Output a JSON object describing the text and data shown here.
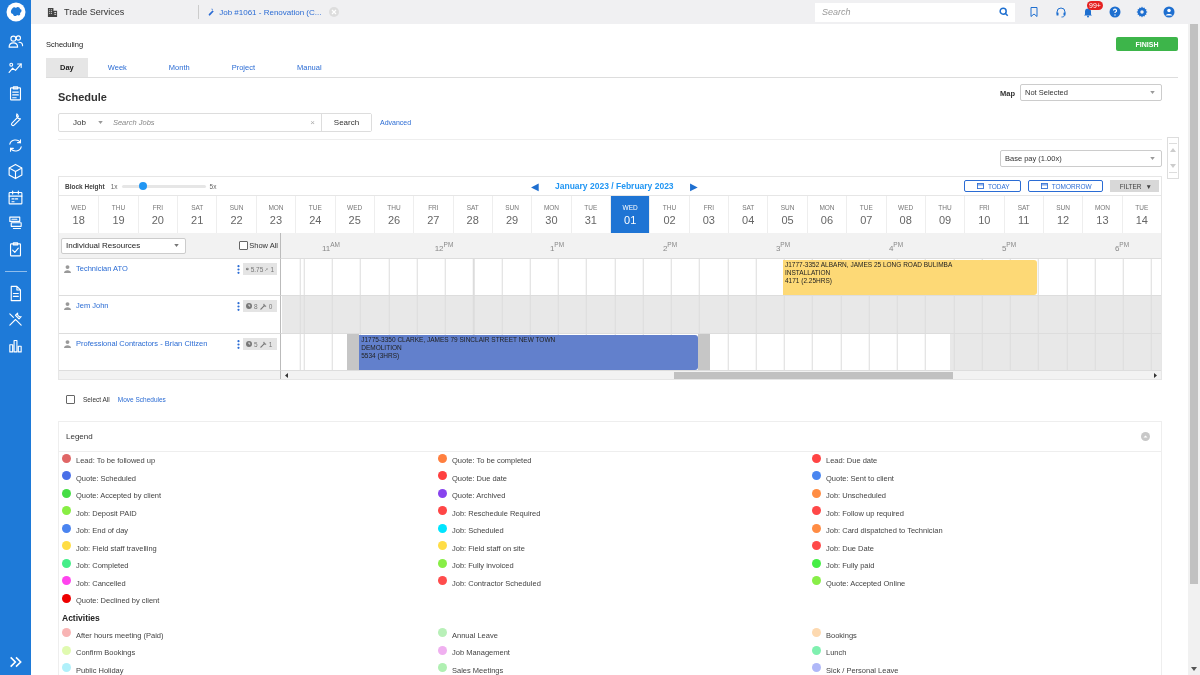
{
  "header": {
    "app": "Trade Services",
    "tab": "Job #1061 - Renovation (C...",
    "search_placeholder": "Search",
    "notifications": "99+"
  },
  "page": {
    "title": "Scheduling",
    "finish": "FINISH"
  },
  "tabs": [
    {
      "label": "Day",
      "selected": true
    },
    {
      "label": "Week",
      "selected": false
    },
    {
      "label": "Month",
      "selected": false
    },
    {
      "label": "Project",
      "selected": false
    },
    {
      "label": "Manual",
      "selected": false
    }
  ],
  "schedule": {
    "title": "Schedule",
    "search": {
      "type": "Job",
      "placeholder": "Search Jobs",
      "clear": "×",
      "button": "Search",
      "advanced": "Advanced"
    },
    "map": {
      "label": "Map",
      "value": "Not Selected"
    },
    "pay_rate": "Base pay (1.00x)"
  },
  "calendar": {
    "block_height": {
      "label": "Block Height",
      "min": "1x",
      "max": "5x",
      "level": 0.26
    },
    "prev": "◀",
    "month": "January 2023 / February 2023",
    "next": "▶",
    "buttons": [
      "TODAY",
      "TOMORROW"
    ],
    "filter": "FILTER",
    "filter_caret": "▼",
    "days": [
      {
        "weekday": "WED",
        "date": "18",
        "selected": false
      },
      {
        "weekday": "THU",
        "date": "19",
        "selected": false
      },
      {
        "weekday": "FRI",
        "date": "20",
        "selected": false
      },
      {
        "weekday": "SAT",
        "date": "21",
        "selected": false
      },
      {
        "weekday": "SUN",
        "date": "22",
        "selected": false
      },
      {
        "weekday": "MON",
        "date": "23",
        "selected": false
      },
      {
        "weekday": "TUE",
        "date": "24",
        "selected": false
      },
      {
        "weekday": "WED",
        "date": "25",
        "selected": false
      },
      {
        "weekday": "THU",
        "date": "26",
        "selected": false
      },
      {
        "weekday": "FRI",
        "date": "27",
        "selected": false
      },
      {
        "weekday": "SAT",
        "date": "28",
        "selected": false
      },
      {
        "weekday": "SUN",
        "date": "29",
        "selected": false
      },
      {
        "weekday": "MON",
        "date": "30",
        "selected": false
      },
      {
        "weekday": "TUE",
        "date": "31",
        "selected": false
      },
      {
        "weekday": "WED",
        "date": "01",
        "selected": true
      },
      {
        "weekday": "THU",
        "date": "02",
        "selected": false
      },
      {
        "weekday": "FRI",
        "date": "03",
        "selected": false
      },
      {
        "weekday": "SAT",
        "date": "04",
        "selected": false
      },
      {
        "weekday": "SUN",
        "date": "05",
        "selected": false
      },
      {
        "weekday": "MON",
        "date": "06",
        "selected": false
      },
      {
        "weekday": "TUE",
        "date": "07",
        "selected": false
      },
      {
        "weekday": "WED",
        "date": "08",
        "selected": false
      },
      {
        "weekday": "THU",
        "date": "09",
        "selected": false
      },
      {
        "weekday": "FRI",
        "date": "10",
        "selected": false
      },
      {
        "weekday": "SAT",
        "date": "11",
        "selected": false
      },
      {
        "weekday": "SUN",
        "date": "12",
        "selected": false
      },
      {
        "weekday": "MON",
        "date": "13",
        "selected": false
      },
      {
        "weekday": "TUE",
        "date": "14",
        "selected": false
      }
    ],
    "resource_view": "Individual Resources",
    "show_all": {
      "label": "Show All",
      "checked": false
    },
    "hours": [
      "11$^{AM}$",
      "12$^{PM}$",
      "1$^{PM}$",
      "2$^{PM}$",
      "3$^{PM}$",
      "4$^{PM}$",
      "5$^{PM}$",
      "6$^{PM}$"
    ],
    "resources": [
      {
        "name": "Technician ATO",
        "hours": "5.75",
        "jobs": "1",
        "availability": {
          "level": 1
        },
        "events": [
          {
            "lines": [
              "J1777-3352 ALBARN, JAMES 25 LONG ROAD BULIMBA",
              "INSTALLATION",
              "4171 (2.25HRS)"
            ],
            "color": "#fdd976",
            "travel": false
          }
        ]
      },
      {
        "name": "Jem John",
        "hours": "8",
        "jobs": "0",
        "availability": {
          "level": 0
        }
      },
      {
        "name": "Professional Contractors - Brian Citizen",
        "hours": "5",
        "jobs": "1",
        "availability": {
          "level": 0.76
        },
        "events": [
          {
            "lines": [
              "J1775-3350 CLARKE, JAMES 79 SINCLAIR STREET NEW TOWN",
              "DEMOLITION",
              "5534 (3HRS)"
            ],
            "color": "#6280cc",
            "travel": true
          }
        ]
      }
    ]
  },
  "selection": {
    "select_all": {
      "label": "Select All",
      "checked": false
    },
    "move": "Move Schedules"
  },
  "legend": {
    "title": "Legend",
    "statuses": [
      {
        "label": "Lead: To be followed up",
        "color": "#e06666"
      },
      {
        "label": "Quote: To be completed",
        "color": "#ff7f3f"
      },
      {
        "label": "Lead: Due date",
        "color": "#ff4444"
      },
      {
        "label": "Quote: Scheduled",
        "color": "#4a6fe8"
      },
      {
        "label": "Quote: Due date",
        "color": "#ff4040"
      },
      {
        "label": "Quote: Sent to client",
        "color": "#4a86f0"
      },
      {
        "label": "Quote: Accepted by client",
        "color": "#44dd44"
      },
      {
        "label": "Quote: Archived",
        "color": "#8844ee"
      },
      {
        "label": "Job: Unscheduled",
        "color": "#ff8c42"
      },
      {
        "label": "Job: Deposit PAID",
        "color": "#88ee44"
      },
      {
        "label": "Job: Reschedule Required",
        "color": "#ff4646"
      },
      {
        "label": "Job: Follow up required",
        "color": "#ff4848"
      },
      {
        "label": "Job: End of day",
        "color": "#4a84f0"
      },
      {
        "label": "Job: Scheduled",
        "color": "#00e5ff"
      },
      {
        "label": "Job: Card dispatched to Technician",
        "color": "#ff8c44"
      },
      {
        "label": "Job: Field staff travelling",
        "color": "#ffdd44"
      },
      {
        "label": "Job: Field staff on site",
        "color": "#ffdd46"
      },
      {
        "label": "Job: Due Date",
        "color": "#ff4a4a"
      },
      {
        "label": "Job: Completed",
        "color": "#44ee88"
      },
      {
        "label": "Job: Fully invoiced",
        "color": "#88ee46"
      },
      {
        "label": "Job: Fully paid",
        "color": "#44ee44"
      },
      {
        "label": "Job: Cancelled",
        "color": "#ff44ee"
      },
      {
        "label": "Job: Contractor Scheduled",
        "color": "#ff4c4c"
      },
      {
        "label": "Quote: Accepted Online",
        "color": "#88ee48"
      },
      {
        "label": "Quote: Declined by client",
        "color": "#ee0000"
      }
    ],
    "activities_title": "Activities",
    "activities": [
      {
        "label": "After hours meeting (Paid)",
        "color": "#f8b4b4"
      },
      {
        "label": "Annual Leave",
        "color": "#b8f0b8"
      },
      {
        "label": "Bookings",
        "color": "#fdd9b0"
      },
      {
        "label": "Confirm Bookings",
        "color": "#e0fab0"
      },
      {
        "label": "Job Management",
        "color": "#f0b0f0"
      },
      {
        "label": "Lunch",
        "color": "#80f0b0"
      },
      {
        "label": "Public Holiday",
        "color": "#b0f0fa"
      },
      {
        "label": "Sales Meetings",
        "color": "#b0f0b2"
      },
      {
        "label": "Sick / Personal Leave",
        "color": "#b0b8f8"
      }
    ]
  }
}
